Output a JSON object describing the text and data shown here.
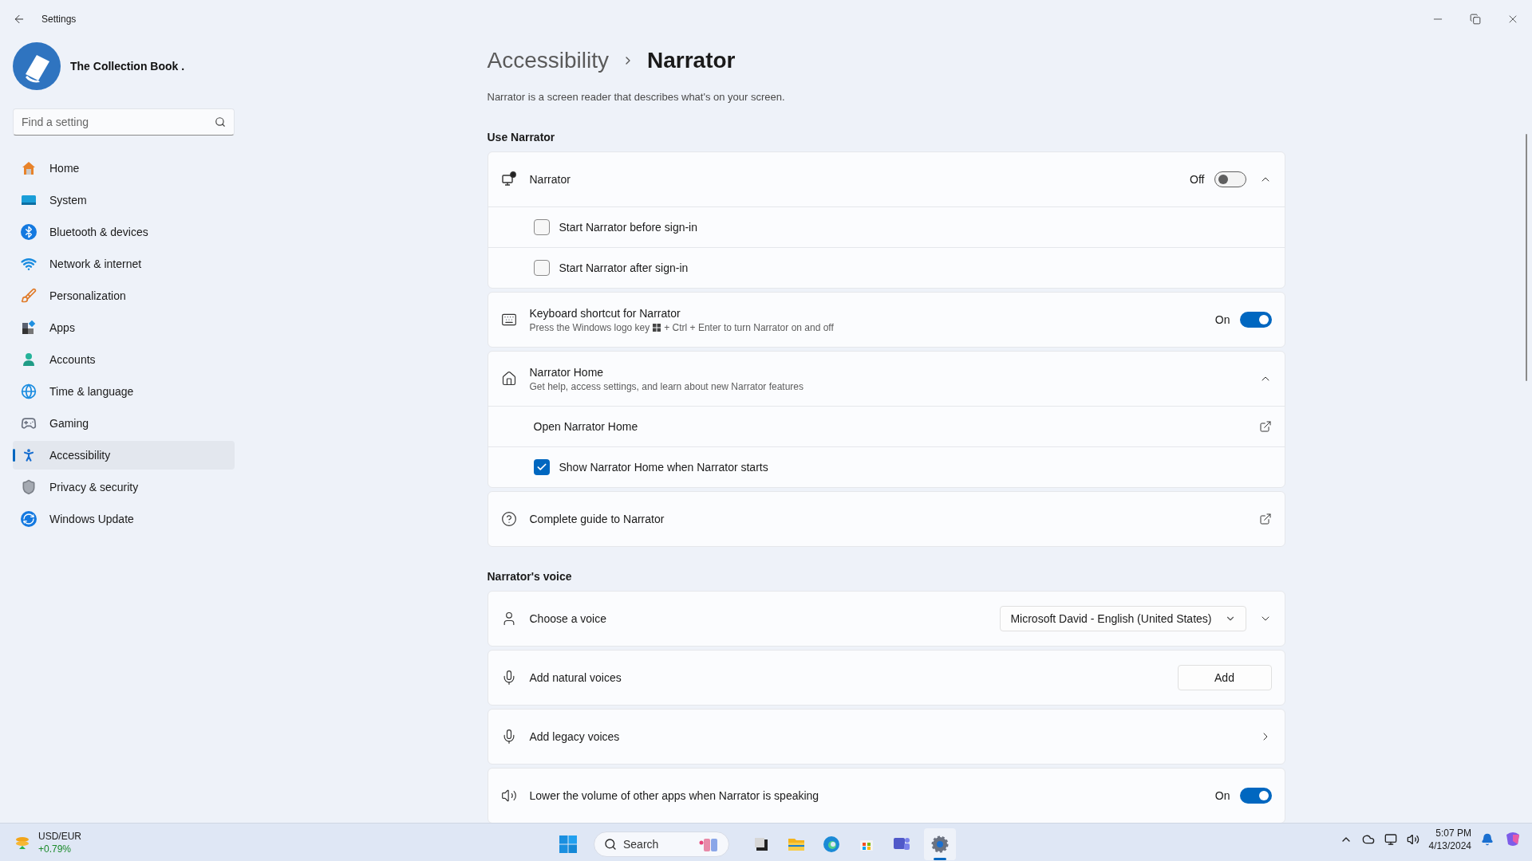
{
  "window": {
    "title": "Settings"
  },
  "profile": {
    "name": "The Collection Book ."
  },
  "search": {
    "placeholder": "Find a setting"
  },
  "nav": [
    {
      "label": "Home",
      "selected": false
    },
    {
      "label": "System",
      "selected": false
    },
    {
      "label": "Bluetooth & devices",
      "selected": false
    },
    {
      "label": "Network & internet",
      "selected": false
    },
    {
      "label": "Personalization",
      "selected": false
    },
    {
      "label": "Apps",
      "selected": false
    },
    {
      "label": "Accounts",
      "selected": false
    },
    {
      "label": "Time & language",
      "selected": false
    },
    {
      "label": "Gaming",
      "selected": false
    },
    {
      "label": "Accessibility",
      "selected": true
    },
    {
      "label": "Privacy & security",
      "selected": false
    },
    {
      "label": "Windows Update",
      "selected": false
    }
  ],
  "breadcrumb": {
    "parent": "Accessibility",
    "current": "Narrator"
  },
  "description": "Narrator is a screen reader that describes what's on your screen.",
  "sections": [
    {
      "heading": "Use Narrator",
      "cards": [
        {
          "kind": "toggle",
          "title": "Narrator",
          "toggle": {
            "label": "Off",
            "on": false
          },
          "expanded": true,
          "children": [
            {
              "kind": "checkbox",
              "label": "Start Narrator before sign-in",
              "checked": false
            },
            {
              "kind": "checkbox",
              "label": "Start Narrator after sign-in",
              "checked": false
            }
          ]
        },
        {
          "kind": "toggle",
          "title": "Keyboard shortcut for Narrator",
          "subtitle_parts": [
            "Press the Windows logo key",
            "+ Ctrl + Enter to turn Narrator on and off"
          ],
          "toggle": {
            "label": "On",
            "on": true
          }
        },
        {
          "kind": "expander",
          "title": "Narrator Home",
          "subtitle": "Get help, access settings, and learn about new Narrator features",
          "expanded": true,
          "children": [
            {
              "kind": "link",
              "label": "Open Narrator Home"
            },
            {
              "kind": "checkbox",
              "label": "Show Narrator Home when Narrator starts",
              "checked": true
            }
          ]
        },
        {
          "kind": "link",
          "title": "Complete guide to Narrator"
        }
      ]
    },
    {
      "heading": "Narrator's voice",
      "cards": [
        {
          "kind": "dropdown",
          "title": "Choose a voice",
          "value": "Microsoft David - English (United States)",
          "expanded": false
        },
        {
          "kind": "button",
          "title": "Add natural voices",
          "button": "Add"
        },
        {
          "kind": "chevron",
          "title": "Add legacy voices"
        },
        {
          "kind": "toggle",
          "title": "Lower the volume of other apps when Narrator is speaking",
          "toggle": {
            "label": "On",
            "on": true
          }
        }
      ]
    }
  ],
  "taskbar": {
    "widget": {
      "title": "USD/EUR",
      "change": "+0.79%"
    },
    "search_placeholder": "Search",
    "time": "5:07 PM",
    "date": "4/13/2024"
  }
}
